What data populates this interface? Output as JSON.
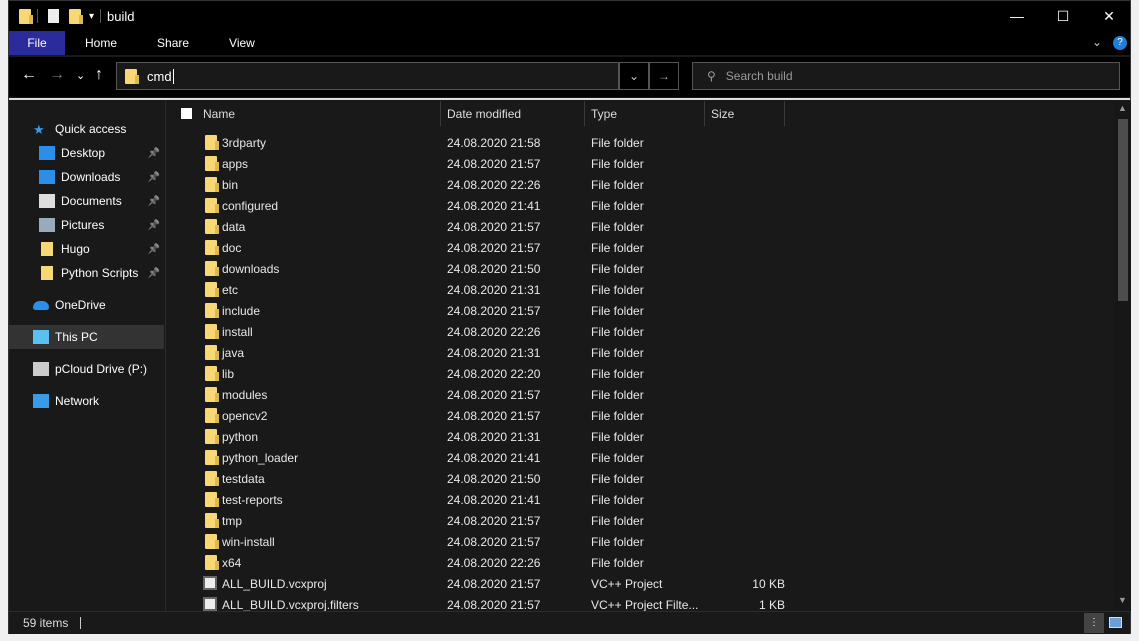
{
  "window": {
    "title": "build"
  },
  "ribbon": {
    "tabs": [
      "File",
      "Home",
      "Share",
      "View"
    ]
  },
  "address": {
    "value": "cmd"
  },
  "search": {
    "placeholder": "Search build"
  },
  "sidebar": {
    "items": [
      {
        "label": "Quick access",
        "icon": "star-icon",
        "indent": 0
      },
      {
        "label": "Desktop",
        "icon": "desktop-icon",
        "indent": 1,
        "pinned": true
      },
      {
        "label": "Downloads",
        "icon": "download-icon",
        "indent": 1,
        "pinned": true
      },
      {
        "label": "Documents",
        "icon": "document-icon",
        "indent": 1,
        "pinned": true
      },
      {
        "label": "Pictures",
        "icon": "pictures-icon",
        "indent": 1,
        "pinned": true
      },
      {
        "label": "Hugo",
        "icon": "folder-icon",
        "indent": 1,
        "pinned": true
      },
      {
        "label": "Python Scripts",
        "icon": "folder-icon",
        "indent": 1,
        "pinned": true
      },
      {
        "label": "OneDrive",
        "icon": "cloud-icon",
        "indent": 0
      },
      {
        "label": "This PC",
        "icon": "computer-icon",
        "indent": 0,
        "selected": true
      },
      {
        "label": "pCloud Drive (P:)",
        "icon": "drive-icon",
        "indent": 0
      },
      {
        "label": "Network",
        "icon": "network-icon",
        "indent": 0
      }
    ]
  },
  "columns": [
    "Name",
    "Date modified",
    "Type",
    "Size"
  ],
  "files": [
    [
      "3rdparty",
      "24.08.2020 21:58",
      "File folder",
      ""
    ],
    [
      "apps",
      "24.08.2020 21:57",
      "File folder",
      ""
    ],
    [
      "bin",
      "24.08.2020 22:26",
      "File folder",
      ""
    ],
    [
      "configured",
      "24.08.2020 21:41",
      "File folder",
      ""
    ],
    [
      "data",
      "24.08.2020 21:57",
      "File folder",
      ""
    ],
    [
      "doc",
      "24.08.2020 21:57",
      "File folder",
      ""
    ],
    [
      "downloads",
      "24.08.2020 21:50",
      "File folder",
      ""
    ],
    [
      "etc",
      "24.08.2020 21:31",
      "File folder",
      ""
    ],
    [
      "include",
      "24.08.2020 21:57",
      "File folder",
      ""
    ],
    [
      "install",
      "24.08.2020 22:26",
      "File folder",
      ""
    ],
    [
      "java",
      "24.08.2020 21:31",
      "File folder",
      ""
    ],
    [
      "lib",
      "24.08.2020 22:20",
      "File folder",
      ""
    ],
    [
      "modules",
      "24.08.2020 21:57",
      "File folder",
      ""
    ],
    [
      "opencv2",
      "24.08.2020 21:57",
      "File folder",
      ""
    ],
    [
      "python",
      "24.08.2020 21:31",
      "File folder",
      ""
    ],
    [
      "python_loader",
      "24.08.2020 21:41",
      "File folder",
      ""
    ],
    [
      "testdata",
      "24.08.2020 21:50",
      "File folder",
      ""
    ],
    [
      "test-reports",
      "24.08.2020 21:41",
      "File folder",
      ""
    ],
    [
      "tmp",
      "24.08.2020 21:57",
      "File folder",
      ""
    ],
    [
      "win-install",
      "24.08.2020 21:57",
      "File folder",
      ""
    ],
    [
      "x64",
      "24.08.2020 22:26",
      "File folder",
      ""
    ],
    [
      "ALL_BUILD.vcxproj",
      "24.08.2020 21:57",
      "VC++ Project",
      "10 KB"
    ],
    [
      "ALL_BUILD.vcxproj.filters",
      "24.08.2020 21:57",
      "VC++ Project Filte...",
      "1 KB"
    ]
  ],
  "status": {
    "count": "59 items"
  }
}
